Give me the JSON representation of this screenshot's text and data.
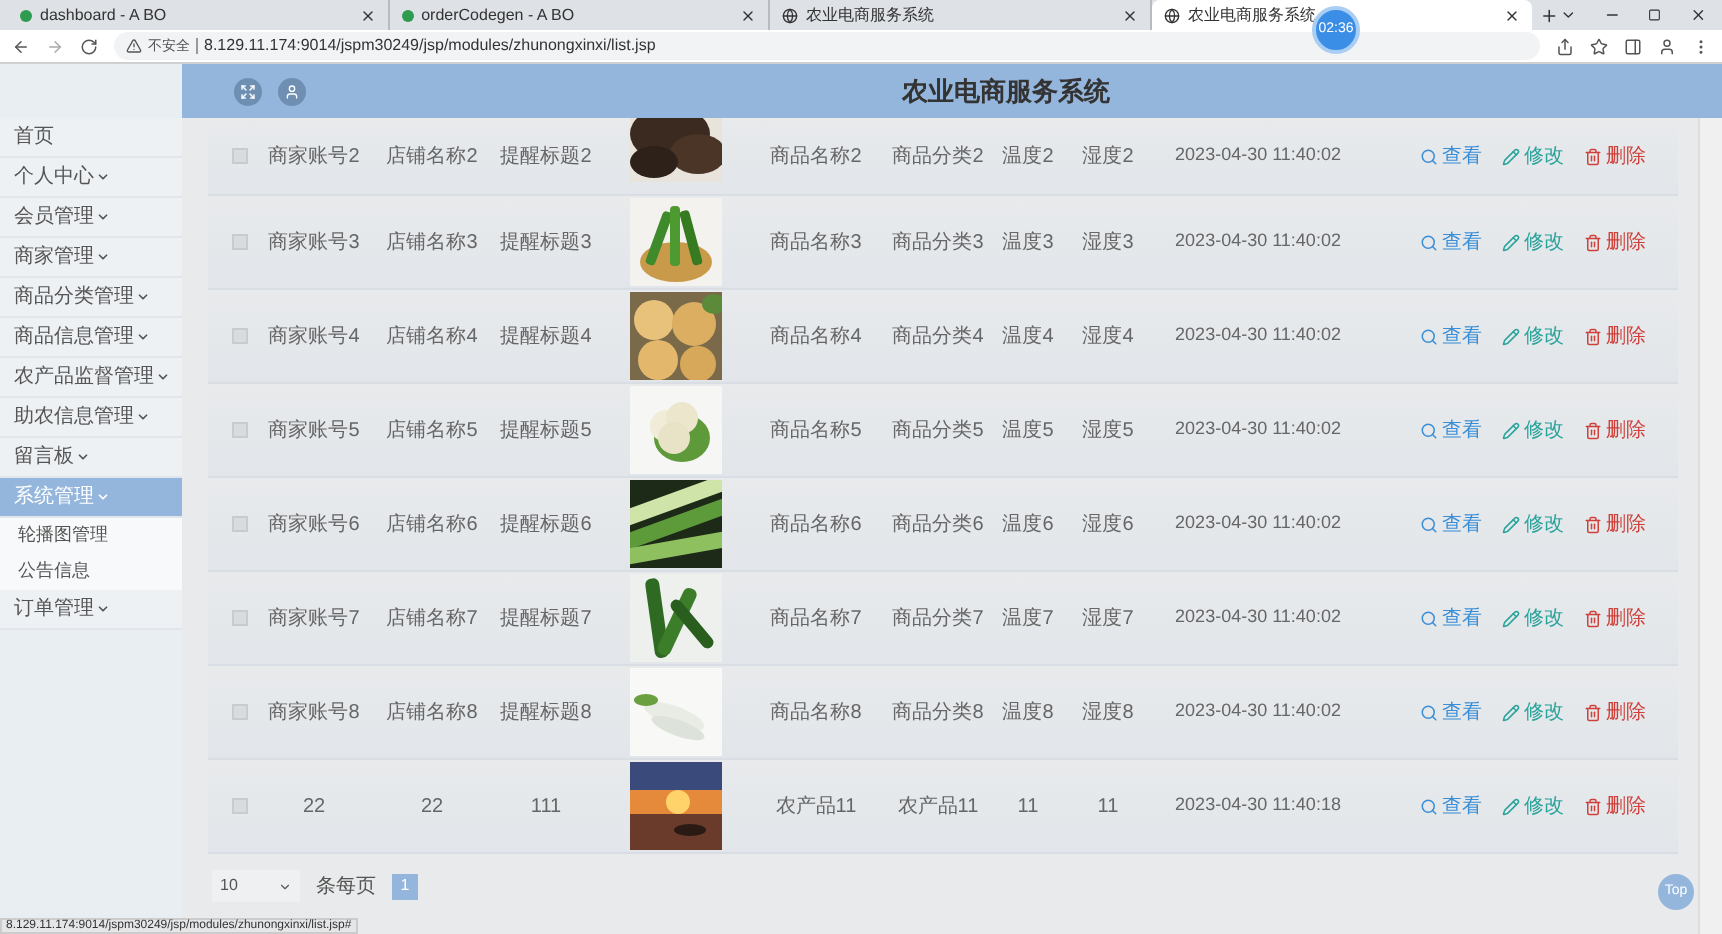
{
  "browser": {
    "tabs": [
      {
        "title": "dashboard - A BO",
        "selected": false
      },
      {
        "title": "orderCodegen - A BO",
        "selected": false
      },
      {
        "title": "农业电商服务系统",
        "selected": false
      },
      {
        "title": "农业电商服务系统",
        "selected": true
      }
    ],
    "clock": "02:36",
    "security": "不安全",
    "url": "8.129.11.174:9014/jspm30249/jsp/modules/zhunongxinxi/list.jsp",
    "status_url": "8.129.11.174:9014/jspm30249/jsp/modules/zhunongxinxi/list.jsp#"
  },
  "app": {
    "title": "农业电商服务系统"
  },
  "sidebar": {
    "items": [
      {
        "label": "首页",
        "dropdown": false,
        "selected": false
      },
      {
        "label": "个人中心",
        "dropdown": true,
        "selected": false
      },
      {
        "label": "会员管理",
        "dropdown": true,
        "selected": false
      },
      {
        "label": "商家管理",
        "dropdown": true,
        "selected": false
      },
      {
        "label": "商品分类管理",
        "dropdown": true,
        "selected": false
      },
      {
        "label": "商品信息管理",
        "dropdown": true,
        "selected": false
      },
      {
        "label": "农产品监督管理",
        "dropdown": true,
        "selected": false
      },
      {
        "label": "助农信息管理",
        "dropdown": true,
        "selected": false
      },
      {
        "label": "留言板",
        "dropdown": true,
        "selected": false
      },
      {
        "label": "系统管理",
        "dropdown": true,
        "selected": true,
        "children": [
          {
            "label": "轮播图管理"
          },
          {
            "label": "公告信息"
          }
        ]
      },
      {
        "label": "订单管理",
        "dropdown": true,
        "selected": false
      }
    ]
  },
  "table": {
    "rows": [
      {
        "checked": false,
        "cells": [
          "商家账号2",
          "店铺名称2",
          "提醒标题2"
        ],
        "picture": {
          "kind": "picture"
        },
        "cells_2": [
          "商品名称2",
          "商品分类2",
          "温度2",
          "湿度2",
          "2023-04-30 11:40:02"
        ],
        "actions": [
          {
            "kind": "view",
            "label": "查看"
          },
          {
            "kind": "edit",
            "label": "修改"
          },
          {
            "kind": "delete",
            "label": "删除"
          }
        ]
      },
      {
        "checked": false,
        "cells": [
          "商家账号3",
          "店铺名称3",
          "提醒标题3"
        ],
        "picture": {
          "kind": "picture"
        },
        "cells_2": [
          "商品名称3",
          "商品分类3",
          "温度3",
          "湿度3",
          "2023-04-30 11:40:02"
        ],
        "actions": [
          {
            "kind": "view",
            "label": "查看"
          },
          {
            "kind": "edit",
            "label": "修改"
          },
          {
            "kind": "delete",
            "label": "删除"
          }
        ]
      },
      {
        "checked": false,
        "cells": [
          "商家账号4",
          "店铺名称4",
          "提醒标题4"
        ],
        "picture": {
          "kind": "picture"
        },
        "cells_2": [
          "商品名称4",
          "商品分类4",
          "温度4",
          "湿度4",
          "2023-04-30 11:40:02"
        ],
        "actions": [
          {
            "kind": "view",
            "label": "查看"
          },
          {
            "kind": "edit",
            "label": "修改"
          },
          {
            "kind": "delete",
            "label": "删除"
          }
        ]
      },
      {
        "checked": false,
        "cells": [
          "商家账号5",
          "店铺名称5",
          "提醒标题5"
        ],
        "picture": {
          "kind": "picture"
        },
        "cells_2": [
          "商品名称5",
          "商品分类5",
          "温度5",
          "湿度5",
          "2023-04-30 11:40:02"
        ],
        "actions": [
          {
            "kind": "view",
            "label": "查看"
          },
          {
            "kind": "edit",
            "label": "修改"
          },
          {
            "kind": "delete",
            "label": "删除"
          }
        ]
      },
      {
        "checked": false,
        "cells": [
          "商家账号6",
          "店铺名称6",
          "提醒标题6"
        ],
        "picture": {
          "kind": "picture"
        },
        "cells_2": [
          "商品名称6",
          "商品分类6",
          "温度6",
          "湿度6",
          "2023-04-30 11:40:02"
        ],
        "actions": [
          {
            "kind": "view",
            "label": "查看"
          },
          {
            "kind": "edit",
            "label": "修改"
          },
          {
            "kind": "delete",
            "label": "删除"
          }
        ]
      },
      {
        "checked": false,
        "cells": [
          "商家账号7",
          "店铺名称7",
          "提醒标题7"
        ],
        "picture": {
          "kind": "picture"
        },
        "cells_2": [
          "商品名称7",
          "商品分类7",
          "温度7",
          "湿度7",
          "2023-04-30 11:40:02"
        ],
        "actions": [
          {
            "kind": "view",
            "label": "查看"
          },
          {
            "kind": "edit",
            "label": "修改"
          },
          {
            "kind": "delete",
            "label": "删除"
          }
        ]
      },
      {
        "checked": false,
        "cells": [
          "商家账号8",
          "店铺名称8",
          "提醒标题8"
        ],
        "picture": {
          "kind": "picture"
        },
        "cells_2": [
          "商品名称8",
          "商品分类8",
          "温度8",
          "湿度8",
          "2023-04-30 11:40:02"
        ],
        "actions": [
          {
            "kind": "view",
            "label": "查看"
          },
          {
            "kind": "edit",
            "label": "修改"
          },
          {
            "kind": "delete",
            "label": "删除"
          }
        ]
      },
      {
        "checked": false,
        "cells": [
          "22",
          "22",
          "111"
        ],
        "picture": {
          "kind": "picture"
        },
        "cells_2": [
          "农产品11",
          "农产品11",
          "11",
          "11",
          "2023-04-30 11:40:18"
        ],
        "actions": [
          {
            "kind": "view",
            "label": "查看"
          },
          {
            "kind": "edit",
            "label": "修改"
          },
          {
            "kind": "delete",
            "label": "删除"
          }
        ]
      }
    ]
  },
  "pagination": {
    "page_size": "10",
    "per_page_label": "条每页",
    "pages": [
      {
        "label": "1",
        "selected": true
      }
    ]
  },
  "top_button": "Top"
}
